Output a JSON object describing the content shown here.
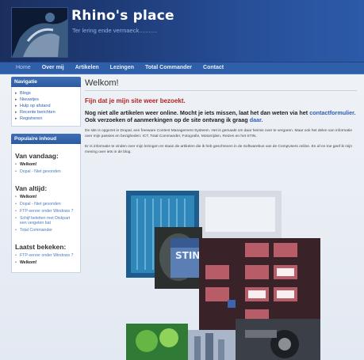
{
  "header": {
    "site_title": "Rhino's place",
    "site_slogan": "Ter lering ende vermaeck..........."
  },
  "nav": {
    "items": [
      {
        "label": "Home",
        "active": true
      },
      {
        "label": "Over mij"
      },
      {
        "label": "Artikelen"
      },
      {
        "label": "Lezingen"
      },
      {
        "label": "Total Commander"
      },
      {
        "label": "Contact"
      }
    ]
  },
  "sidebar": {
    "navigation_title": "Navigatie",
    "navigation_items": [
      "Blogs",
      "Nieuwtjes",
      "Hulp op afstand",
      "Recente berichten",
      "Registreren"
    ],
    "popular_title": "Populaire inhoud",
    "today_heading": "Van vandaag:",
    "today_items": [
      "Welkom!",
      "Dopal - Niet gevonden"
    ],
    "alltime_heading": "Van altijd:",
    "alltime_items": [
      "Welkom!",
      "Dopal - Niet gevonden",
      "FTP-server onder Windows 7",
      "Schijf beletten met Diskpart een vergeten bat",
      "Total Commander"
    ],
    "recent_heading": "Laatst bekeken:",
    "recent_items": [
      "FTP-server onder Windows 7",
      "Welkom!"
    ]
  },
  "content": {
    "title": "Welkom!",
    "intro_red": "Fijn dat je mijn site weer bezoekt.",
    "intro_bold_1": "Nog niet alle artikelen weer online. Mocht je iets missen, laat het dan weten via het",
    "contact_link": "contactformulier.",
    "intro_bold_2": "Ook verzoeken of aanmerkingen op de site ontvang ik graag",
    "here_link": "daar.",
    "paragraph_1": "De site is opgezet in Drupal, een freeware Content Management Systeem. Het is gemaakt om daar heimis over te vergaren. Maar ook het delen van informatie over mijn passies en bezigheden: ICT, Total Commander, Fotografie, Motorrijden, Reizen en het STIN.",
    "paragraph_2": "Er is informatie te vinden over mijn lezingen en staan de artikelen die ik heb geschreven in de Softwarebus van de CompUsers online. En af en toe geef ik mijn mening over iets in de blog.",
    "collage_label": "STIN"
  },
  "colors": {
    "header_dark": "#1b2f5e",
    "nav_blue": "#2f5fa9",
    "accent_red": "#b02322",
    "link_blue": "#2b5fb0"
  }
}
